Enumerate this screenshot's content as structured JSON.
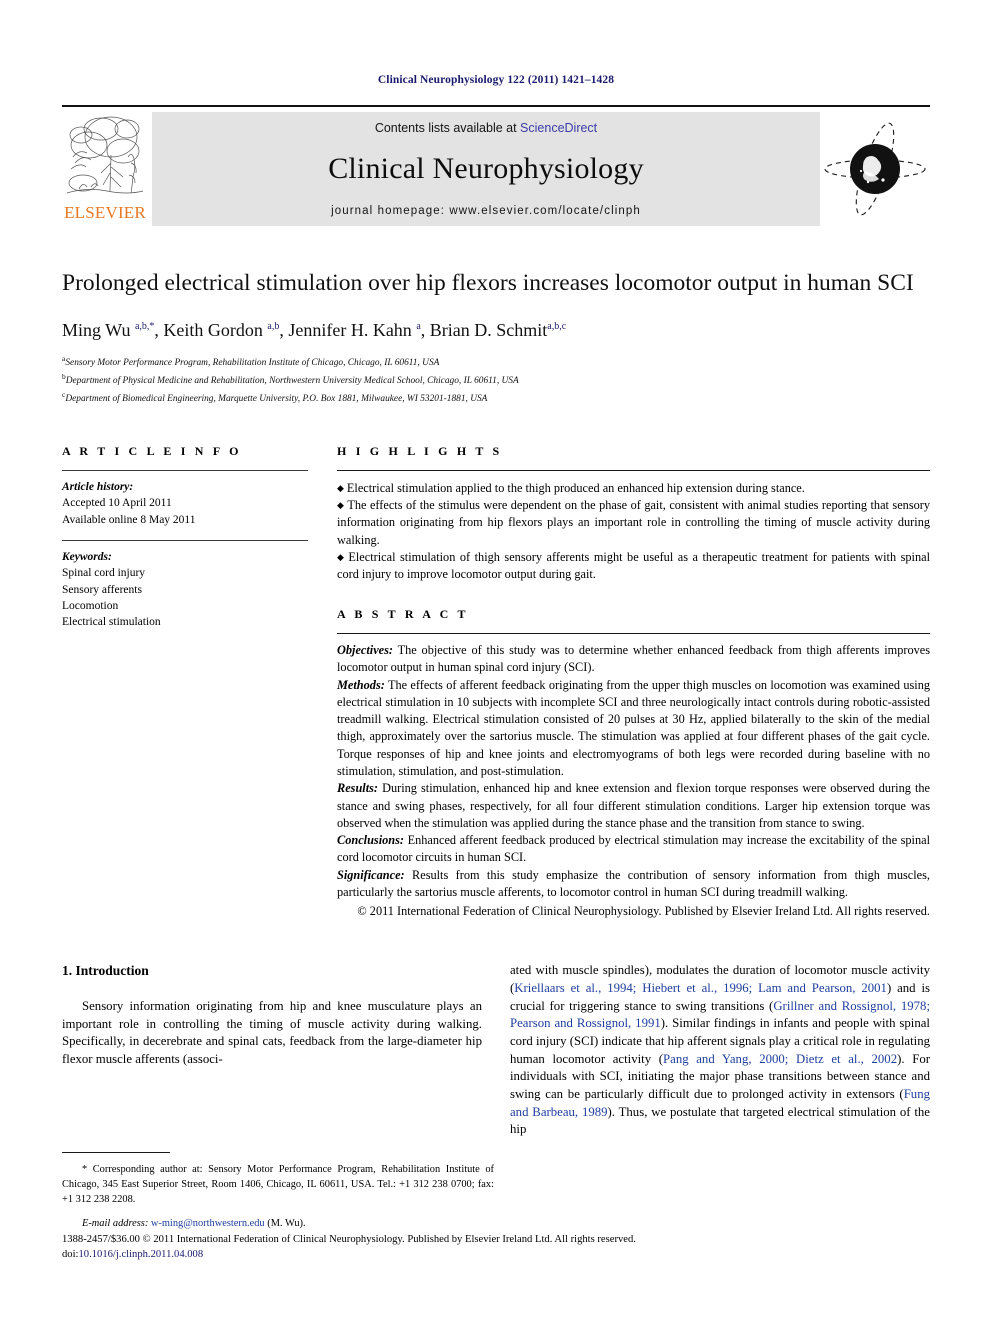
{
  "running_head": "Clinical Neurophysiology 122 (2011) 1421–1428",
  "masthead": {
    "publisher_name": "ELSEVIER",
    "contents_prefix": "Contents lists available at ",
    "contents_link": "ScienceDirect",
    "journal_name": "Clinical Neurophysiology",
    "homepage": "journal homepage: www.elsevier.com/locate/clinph"
  },
  "article": {
    "title": "Prolonged electrical stimulation over hip flexors increases locomotor output in human SCI",
    "authors_html": "Ming Wu <sup>a,b,*</sup>, Keith Gordon <sup>a,b</sup>, Jennifer H. Kahn <sup>a</sup>, Brian D. Schmit<sup>a,b,c</sup>",
    "affiliations": [
      {
        "marker": "a",
        "text": "Sensory Motor Performance Program, Rehabilitation Institute of Chicago, Chicago, IL 60611, USA"
      },
      {
        "marker": "b",
        "text": "Department of Physical Medicine and Rehabilitation, Northwestern University Medical School, Chicago, IL 60611, USA"
      },
      {
        "marker": "c",
        "text": "Department of Biomedical Engineering, Marquette University, P.O. Box 1881, Milwaukee, WI 53201-1881, USA"
      }
    ]
  },
  "article_info": {
    "heading": "A R T I C L E    I N F O",
    "history_label": "Article history:",
    "history": [
      "Accepted 10 April 2011",
      "Available online 8 May 2011"
    ],
    "keywords_label": "Keywords:",
    "keywords": [
      "Spinal cord injury",
      "Sensory afferents",
      "Locomotion",
      "Electrical stimulation"
    ]
  },
  "highlights": {
    "heading": "H I G H L I G H T S",
    "items": [
      "Electrical stimulation applied to the thigh produced an enhanced hip extension during stance.",
      "The effects of the stimulus were dependent on the phase of gait, consistent with animal studies reporting that sensory information originating from hip flexors plays an important role in controlling the timing of muscle activity during walking.",
      "Electrical stimulation of thigh sensory afferents might be useful as a therapeutic treatment for patients with spinal cord injury to improve locomotor output during gait."
    ]
  },
  "abstract": {
    "heading": "A B S T R A C T",
    "sections": [
      {
        "label": "Objectives:",
        "text": " The objective of this study was to determine whether enhanced feedback from thigh afferents improves locomotor output in human spinal cord injury (SCI)."
      },
      {
        "label": "Methods:",
        "text": " The effects of afferent feedback originating from the upper thigh muscles on locomotion was examined using electrical stimulation in 10 subjects with incomplete SCI and three neurologically intact controls during robotic-assisted treadmill walking. Electrical stimulation consisted of 20 pulses at 30 Hz, applied bilaterally to the skin of the medial thigh, approximately over the sartorius muscle. The stimulation was applied at four different phases of the gait cycle. Torque responses of hip and knee joints and electromyograms of both legs were recorded during baseline with no stimulation, stimulation, and post-stimulation."
      },
      {
        "label": "Results:",
        "text": " During stimulation, enhanced hip and knee extension and flexion torque responses were observed during the stance and swing phases, respectively, for all four different stimulation conditions. Larger hip extension torque was observed when the stimulation was applied during the stance phase and the transition from stance to swing."
      },
      {
        "label": "Conclusions:",
        "text": " Enhanced afferent feedback produced by electrical stimulation may increase the excitability of the spinal cord locomotor circuits in human SCI."
      },
      {
        "label": "Significance:",
        "text": " Results from this study emphasize the contribution of sensory information from thigh muscles, particularly the sartorius muscle afferents, to locomotor control in human SCI during treadmill walking."
      }
    ],
    "copyright": "© 2011 International Federation of Clinical Neurophysiology. Published by Elsevier Ireland Ltd. All rights reserved."
  },
  "introduction": {
    "heading": "1. Introduction",
    "left_paragraph": "Sensory information originating from hip and knee musculature plays an important role in controlling the timing of muscle activity during walking. Specifically, in decerebrate and spinal cats, feedback from the large-diameter hip flexor muscle afferents (associ-",
    "right_parts": [
      {
        "type": "text",
        "value": "ated with muscle spindles), modulates the duration of locomotor muscle activity ("
      },
      {
        "type": "cite",
        "value": "Kriellaars et al., 1994; Hiebert et al., 1996; Lam and Pearson, 2001"
      },
      {
        "type": "text",
        "value": ") and is crucial for triggering stance to swing transitions ("
      },
      {
        "type": "cite",
        "value": "Grillner and Rossignol, 1978; Pearson and Rossignol, 1991"
      },
      {
        "type": "text",
        "value": "). Similar findings in infants and people with spinal cord injury (SCI) indicate that hip afferent signals play a critical role in regulating human locomotor activity ("
      },
      {
        "type": "cite",
        "value": "Pang and Yang, 2000; Dietz et al., 2002"
      },
      {
        "type": "text",
        "value": "). For individuals with SCI, initiating the major phase transitions between stance and swing can be particularly difficult due to prolonged activity in extensors ("
      },
      {
        "type": "cite",
        "value": "Fung and Barbeau, 1989"
      },
      {
        "type": "text",
        "value": "). Thus, we postulate that targeted electrical stimulation of the hip"
      }
    ]
  },
  "footnote": {
    "corresponding": "* Corresponding author at: Sensory Motor Performance Program, Rehabilitation Institute of Chicago, 345 East Superior Street, Room 1406, Chicago, IL 60611, USA. Tel.: +1 312 238 0700; fax: +1 312 238 2208.",
    "email_label": "E-mail address:",
    "email": "w-ming@northwestern.edu",
    "email_suffix": " (M. Wu)."
  },
  "page_footer": {
    "issn_line": "1388-2457/$36.00 © 2011 International Federation of Clinical Neurophysiology. Published by Elsevier Ireland Ltd. All rights reserved.",
    "doi_prefix": "doi:",
    "doi": "10.1016/j.clinph.2011.04.008"
  },
  "colors": {
    "running_head": "#1a1a6e",
    "link": "#3b3ba8",
    "citation": "#1f3f9e",
    "elsevier_orange": "#E87722",
    "banner_bg": "#e3e3e3"
  }
}
